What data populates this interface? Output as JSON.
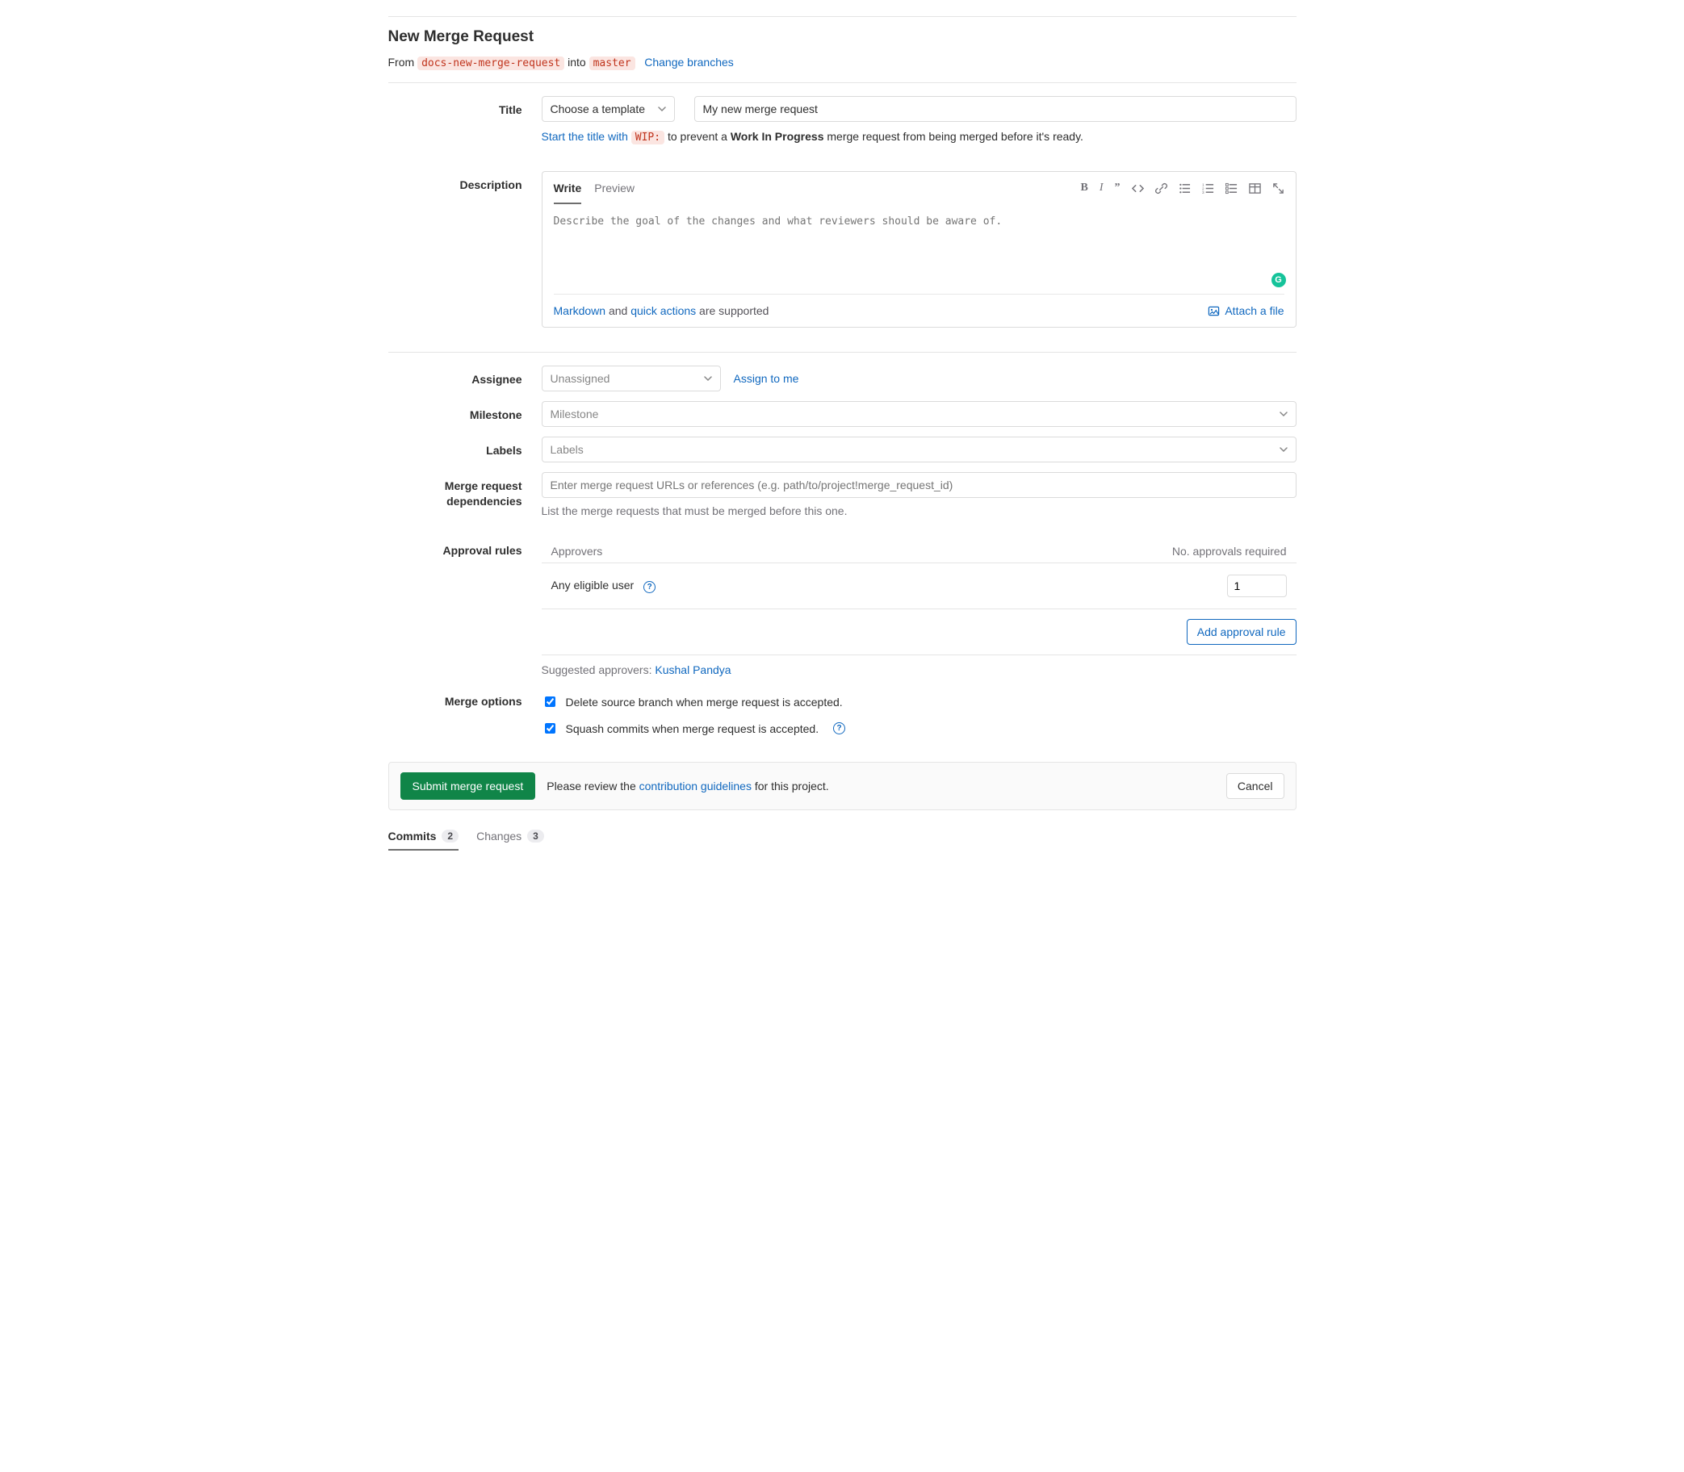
{
  "header": {
    "title": "New Merge Request",
    "from_label": "From",
    "source_branch": "docs-new-merge-request",
    "into_label": "into",
    "target_branch": "master",
    "change_branches": "Change branches"
  },
  "title_section": {
    "label": "Title",
    "template_dropdown": "Choose a template",
    "value": "My new merge request",
    "hint_prefix_link": "Start the title with",
    "hint_code": "WIP:",
    "hint_mid": "to prevent a",
    "hint_bold": "Work In Progress",
    "hint_suffix": "merge request from being merged before it's ready."
  },
  "description_section": {
    "label": "Description",
    "tabs": {
      "write": "Write",
      "preview": "Preview"
    },
    "placeholder": "Describe the goal of the changes and what reviewers should be aware of.",
    "footer_markdown": "Markdown",
    "footer_and": " and ",
    "footer_quick": "quick actions",
    "footer_suffix": " are supported",
    "attach": "Attach a file"
  },
  "assignee": {
    "label": "Assignee",
    "value": "Unassigned",
    "assign_me": "Assign to me"
  },
  "milestone": {
    "label": "Milestone",
    "placeholder": "Milestone"
  },
  "labels": {
    "label": "Labels",
    "placeholder": "Labels"
  },
  "dependencies": {
    "label": "Merge request dependencies",
    "placeholder": "Enter merge request URLs or references (e.g. path/to/project!merge_request_id)",
    "help": "List the merge requests that must be merged before this one."
  },
  "approval": {
    "label": "Approval rules",
    "col_approvers": "Approvers",
    "col_required": "No. approvals required",
    "row_name": "Any eligible user",
    "row_value": "1",
    "add_rule": "Add approval rule",
    "suggested_prefix": "Suggested approvers: ",
    "suggested_link": "Kushal Pandya"
  },
  "merge_options": {
    "label": "Merge options",
    "delete_branch": "Delete source branch when merge request is accepted.",
    "squash": "Squash commits when merge request is accepted."
  },
  "submit": {
    "button": "Submit merge request",
    "review_prefix": "Please review the ",
    "guidelines": "contribution guidelines",
    "review_suffix": " for this project.",
    "cancel": "Cancel"
  },
  "bottom_tabs": {
    "commits": "Commits",
    "commits_count": "2",
    "changes": "Changes",
    "changes_count": "3"
  }
}
